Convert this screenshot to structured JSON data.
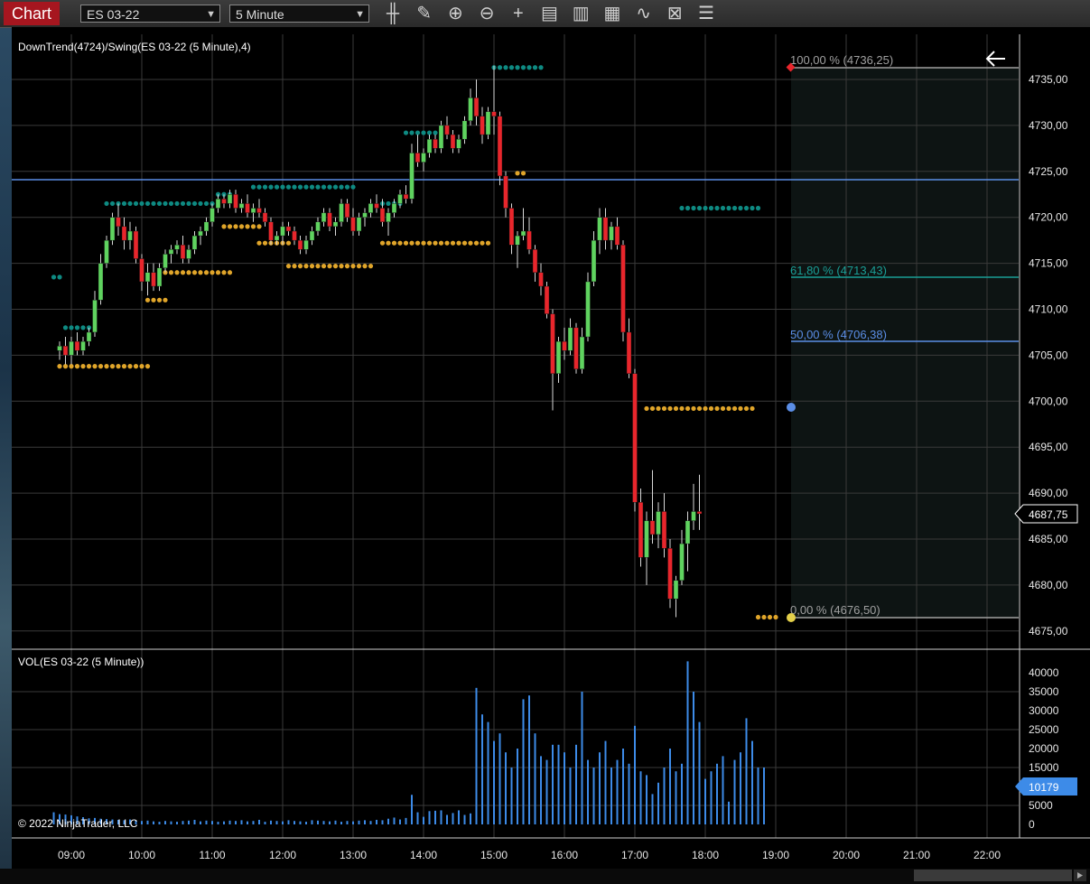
{
  "toolbar": {
    "chart_label": "Chart",
    "instrument": "ES 03-22",
    "interval": "5 Minute",
    "icons": [
      "bar-type-icon",
      "drawing-tool-icon",
      "zoom-in-icon",
      "zoom-out-icon",
      "crosshair-icon",
      "data-box-icon",
      "chart-trader-icon",
      "templates-icon",
      "strategies-icon",
      "properties-icon",
      "share-icon",
      "indicators-list-icon"
    ]
  },
  "price_panel": {
    "title": "DownTrend(4724)/Swing(ES 03-22 (5 Minute),4)",
    "y_ticks": [
      "4735,00",
      "4730,00",
      "4725,00",
      "4720,00",
      "4715,00",
      "4710,00",
      "4705,00",
      "4700,00",
      "4695,00",
      "4690,00",
      "4685,00",
      "4680,00",
      "4675,00"
    ],
    "last_price": "4687,75",
    "fib_labels": [
      "100,00 % (4736,25)",
      "61,80 % (4713,43)",
      "50,00 % (4706,38)",
      "0,00 % (4676,50)"
    ],
    "downtrend_level": 4724
  },
  "volume_panel": {
    "title": "VOL(ES 03-22 (5 Minute))",
    "y_ticks": [
      "40000",
      "35000",
      "30000",
      "25000",
      "20000",
      "15000",
      "10000",
      "5000",
      "0"
    ],
    "last_volume": "10179"
  },
  "x_ticks": [
    "09:00",
    "10:00",
    "11:00",
    "12:00",
    "13:00",
    "14:00",
    "15:00",
    "16:00",
    "17:00",
    "18:00",
    "19:00",
    "20:00",
    "21:00",
    "22:00"
  ],
  "copyright": "© 2022 NinjaTrader, LLC",
  "colors": {
    "up": "#5fd35f",
    "down": "#e8262c",
    "swing_high": "#0e8a82",
    "swing_low": "#e0a52a",
    "downtrend_line": "#5b8ee6",
    "volume": "#3d8be8",
    "fib_618": "#1a9e96",
    "fib_50": "#5b8ee6",
    "fib_0_100": "#a0a0a0"
  },
  "chart_data": {
    "type": "candlestick",
    "interval_minutes": 5,
    "candles": [
      [
        "08:45",
        4705.5,
        4706.5,
        4704.5,
        4706
      ],
      [
        "08:50",
        4706,
        4707,
        4704,
        4705
      ],
      [
        "08:55",
        4705,
        4707,
        4704,
        4706.5
      ],
      [
        "09:00",
        4706.5,
        4707.5,
        4705,
        4705.5
      ],
      [
        "09:05",
        4705.5,
        4707,
        4705,
        4706.5
      ],
      [
        "09:10",
        4706.5,
        4708,
        4706,
        4707.5
      ],
      [
        "09:15",
        4707.5,
        4712,
        4707,
        4711
      ],
      [
        "09:20",
        4711,
        4716,
        4710.5,
        4715
      ],
      [
        "09:25",
        4715,
        4718,
        4714.5,
        4717.5
      ],
      [
        "09:30",
        4717.5,
        4720.5,
        4717,
        4720
      ],
      [
        "09:35",
        4720,
        4721.5,
        4718,
        4719
      ],
      [
        "09:40",
        4719,
        4720,
        4716.5,
        4717.5
      ],
      [
        "09:45",
        4717.5,
        4719.5,
        4716.5,
        4718.5
      ],
      [
        "09:50",
        4718.5,
        4719,
        4715,
        4715.5
      ],
      [
        "09:55",
        4715.5,
        4716,
        4712,
        4713
      ],
      [
        "10:00",
        4713,
        4715,
        4711.5,
        4714
      ],
      [
        "10:05",
        4714,
        4715,
        4712,
        4712.5
      ],
      [
        "10:10",
        4712.5,
        4715,
        4712,
        4714.5
      ],
      [
        "10:15",
        4714.5,
        4716.5,
        4714,
        4716
      ],
      [
        "10:20",
        4716,
        4717,
        4715,
        4716.5
      ],
      [
        "10:25",
        4716.5,
        4717.5,
        4716,
        4717
      ],
      [
        "10:30",
        4717,
        4718,
        4715,
        4715.5
      ],
      [
        "10:35",
        4715.5,
        4717,
        4715,
        4716.5
      ],
      [
        "10:40",
        4716.5,
        4718.5,
        4716,
        4718
      ],
      [
        "10:45",
        4718,
        4719,
        4717,
        4718.5
      ],
      [
        "10:50",
        4718.5,
        4720,
        4718,
        4719.5
      ],
      [
        "10:55",
        4719.5,
        4721.5,
        4719,
        4721
      ],
      [
        "11:00",
        4721,
        4722.5,
        4720.5,
        4722
      ],
      [
        "11:05",
        4722,
        4722.5,
        4721,
        4721.5
      ],
      [
        "11:10",
        4721.5,
        4723,
        4721,
        4722.5
      ],
      [
        "11:15",
        4722.5,
        4723,
        4720.5,
        4721
      ],
      [
        "11:20",
        4721,
        4722,
        4720.5,
        4721.5
      ],
      [
        "11:25",
        4721.5,
        4722.5,
        4720,
        4720.5
      ],
      [
        "11:30",
        4720.5,
        4721.5,
        4719.5,
        4721
      ],
      [
        "11:35",
        4721,
        4722,
        4720,
        4720.5
      ],
      [
        "11:40",
        4720.5,
        4721,
        4719,
        4719.5
      ],
      [
        "11:45",
        4719.5,
        4720,
        4717,
        4717.5
      ],
      [
        "11:50",
        4717.5,
        4718.5,
        4717,
        4718
      ],
      [
        "11:55",
        4718,
        4719.5,
        4717,
        4719
      ],
      [
        "12:00",
        4719,
        4719.5,
        4718,
        4718.5
      ],
      [
        "12:05",
        4718.5,
        4719,
        4717,
        4717.5
      ],
      [
        "12:10",
        4717.5,
        4718,
        4716,
        4716.5
      ],
      [
        "12:15",
        4716.5,
        4718,
        4716,
        4717.5
      ],
      [
        "12:20",
        4717.5,
        4719,
        4717,
        4718.5
      ],
      [
        "12:25",
        4718.5,
        4720,
        4718,
        4719.5
      ],
      [
        "12:30",
        4719.5,
        4721,
        4719,
        4720.5
      ],
      [
        "12:35",
        4720.5,
        4721,
        4718.5,
        4719
      ],
      [
        "12:40",
        4719,
        4720,
        4718,
        4719.5
      ],
      [
        "12:45",
        4719.5,
        4722,
        4719,
        4721.5
      ],
      [
        "12:50",
        4721.5,
        4722,
        4719.5,
        4720
      ],
      [
        "12:55",
        4720,
        4721,
        4718,
        4718.5
      ],
      [
        "13:00",
        4718.5,
        4720.5,
        4718,
        4720
      ],
      [
        "13:05",
        4720,
        4721,
        4719,
        4720.5
      ],
      [
        "13:10",
        4720.5,
        4722,
        4720,
        4721.5
      ],
      [
        "13:15",
        4721.5,
        4722.5,
        4720.5,
        4721
      ],
      [
        "13:20",
        4721,
        4722,
        4719,
        4719.5
      ],
      [
        "13:25",
        4719.5,
        4721,
        4718,
        4720.5
      ],
      [
        "13:30",
        4720.5,
        4722,
        4720,
        4721.5
      ],
      [
        "13:35",
        4721.5,
        4723,
        4721,
        4722.5
      ],
      [
        "13:40",
        4722.5,
        4723.5,
        4721.5,
        4722
      ],
      [
        "13:45",
        4722,
        4728,
        4721.5,
        4727
      ],
      [
        "13:50",
        4727,
        4729,
        4725.5,
        4726
      ],
      [
        "13:55",
        4726,
        4727.5,
        4725,
        4727
      ],
      [
        "14:00",
        4727,
        4729,
        4726.5,
        4728.5
      ],
      [
        "14:05",
        4728.5,
        4729,
        4727,
        4727.5
      ],
      [
        "14:10",
        4727.5,
        4730.5,
        4727,
        4730
      ],
      [
        "14:15",
        4730,
        4731,
        4728.5,
        4729
      ],
      [
        "14:20",
        4729,
        4729.5,
        4727,
        4727.5
      ],
      [
        "14:25",
        4727.5,
        4729,
        4727,
        4728.5
      ],
      [
        "14:30",
        4728.5,
        4731,
        4728,
        4730.5
      ],
      [
        "14:35",
        4730.5,
        4734,
        4730,
        4733
      ],
      [
        "14:40",
        4733,
        4735,
        4730,
        4731
      ],
      [
        "14:45",
        4731,
        4732,
        4728,
        4729
      ],
      [
        "14:50",
        4729,
        4732,
        4728.5,
        4731.5
      ],
      [
        "14:55",
        4731.5,
        4736.5,
        4729,
        4731
      ],
      [
        "15:00",
        4731,
        4731.5,
        4723.5,
        4724.5
      ],
      [
        "15:05",
        4724.5,
        4725,
        4720,
        4721
      ],
      [
        "15:10",
        4721,
        4721.5,
        4716,
        4717
      ],
      [
        "15:15",
        4717,
        4718.5,
        4714.5,
        4718
      ],
      [
        "15:20",
        4718,
        4721,
        4717.5,
        4718.5
      ],
      [
        "15:25",
        4718.5,
        4720,
        4716,
        4716.5
      ],
      [
        "15:30",
        4716.5,
        4717,
        4713,
        4714
      ],
      [
        "15:35",
        4714,
        4715,
        4711.5,
        4712.5
      ],
      [
        "15:40",
        4712.5,
        4713,
        4709,
        4709.5
      ],
      [
        "15:45",
        4709.5,
        4710,
        4699,
        4703
      ],
      [
        "15:50",
        4703,
        4707,
        4702,
        4706.5
      ],
      [
        "15:55",
        4706.5,
        4708,
        4704.5,
        4705.5
      ],
      [
        "16:00",
        4705.5,
        4709,
        4705,
        4708
      ],
      [
        "16:05",
        4708,
        4708.5,
        4703,
        4703.5
      ],
      [
        "16:10",
        4703.5,
        4708,
        4703,
        4707
      ],
      [
        "16:15",
        4707,
        4714,
        4706.5,
        4713
      ],
      [
        "16:20",
        4713,
        4718.5,
        4712.5,
        4717.5
      ],
      [
        "16:25",
        4717.5,
        4721,
        4716,
        4720
      ],
      [
        "16:30",
        4720,
        4721,
        4716.5,
        4717.5
      ],
      [
        "16:35",
        4717.5,
        4719.5,
        4716.5,
        4719
      ],
      [
        "16:40",
        4719,
        4720,
        4716.5,
        4717
      ],
      [
        "16:45",
        4717,
        4717.5,
        4706.5,
        4707.5
      ],
      [
        "16:50",
        4707.5,
        4709,
        4702.5,
        4703
      ],
      [
        "16:55",
        4703,
        4703.5,
        4688,
        4689
      ],
      [
        "17:00",
        4689,
        4690.5,
        4682,
        4683
      ],
      [
        "17:05",
        4683,
        4688,
        4680,
        4687
      ],
      [
        "17:10",
        4687,
        4692.5,
        4684.5,
        4685.5
      ],
      [
        "17:15",
        4685.5,
        4689,
        4684,
        4688
      ],
      [
        "17:20",
        4688,
        4690,
        4683,
        4684
      ],
      [
        "17:25",
        4684,
        4685,
        4677.5,
        4678.5
      ],
      [
        "17:30",
        4678.5,
        4681,
        4676.5,
        4680.5
      ],
      [
        "17:35",
        4680.5,
        4686,
        4680,
        4684.5
      ],
      [
        "17:40",
        4684.5,
        4688,
        4681.5,
        4687
      ],
      [
        "17:45",
        4687,
        4691,
        4686,
        4688
      ],
      [
        "17:50",
        4688,
        4692,
        4686,
        4687.75
      ]
    ],
    "volume": [
      3200,
      2700,
      2600,
      2400,
      2100,
      1900,
      1600,
      1700,
      1500,
      1400,
      1300,
      1200,
      1100,
      1300,
      1000,
      900,
      1000,
      800,
      700,
      900,
      800,
      700,
      900,
      1000,
      1200,
      800,
      1000,
      900,
      700,
      800,
      1000,
      900,
      1100,
      800,
      900,
      1200,
      700,
      1000,
      900,
      800,
      1100,
      900,
      800,
      700,
      1100,
      1000,
      900,
      800,
      1000,
      700,
      900,
      800,
      1000,
      1100,
      900,
      1200,
      1100,
      1500,
      1800,
      1300,
      1700,
      7800,
      3200,
      2000,
      3500,
      3600,
      3700,
      2500,
      3000,
      3700,
      2500,
      2900,
      36000,
      29000,
      27000,
      22000,
      24000,
      19000,
      15000,
      20000,
      33000,
      34000,
      24000,
      18000,
      17000,
      21000,
      21000,
      19000,
      15000,
      21000,
      35000,
      17000,
      15000,
      19000,
      22000,
      15000,
      17000,
      20000,
      16000,
      26000,
      14000,
      13000,
      8000,
      11000,
      15000,
      20000,
      14000,
      16000,
      43000,
      35000,
      27000,
      12000,
      14000,
      16000,
      18000,
      6000,
      17000,
      19000,
      28000,
      22000,
      15000,
      15000
    ],
    "y_range": [
      4672.5,
      4740
    ],
    "volume_range": [
      0,
      44000
    ],
    "x_range": [
      "08:40",
      "22:30"
    ]
  }
}
